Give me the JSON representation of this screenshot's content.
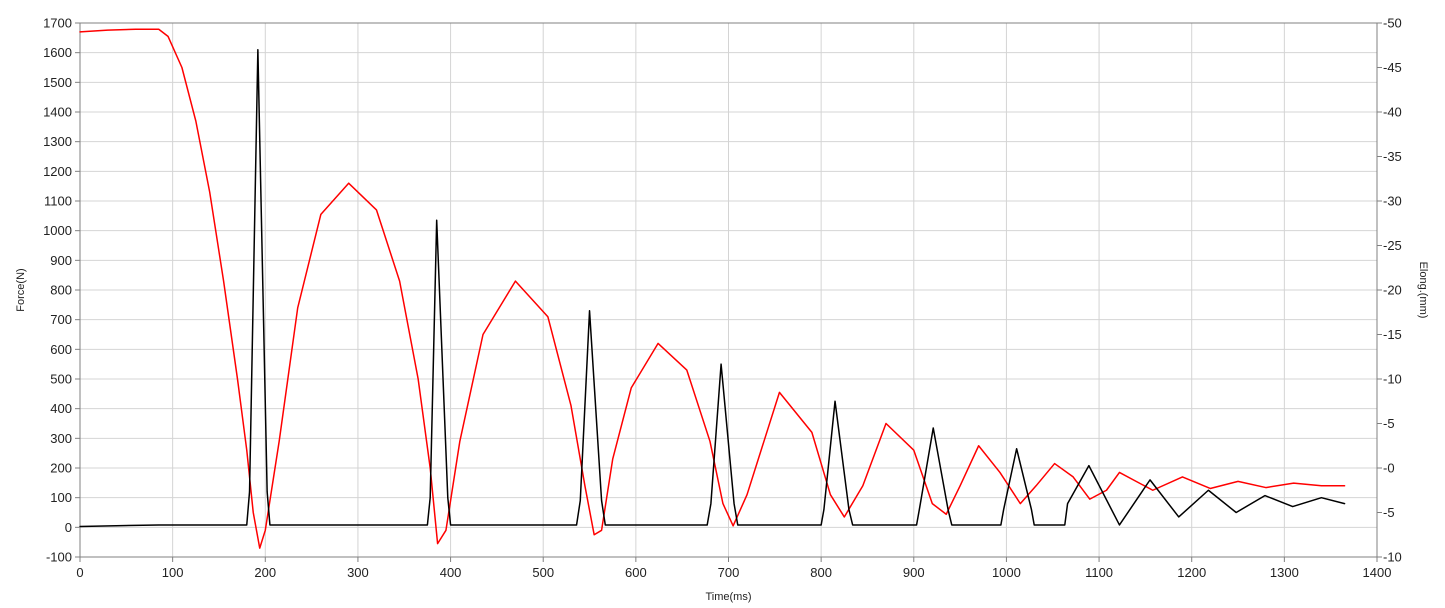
{
  "chart_data": {
    "type": "line",
    "xlabel": "Time(ms)",
    "ylabel": "Force(N)",
    "y2label": "Elong.(mm)",
    "xlim": [
      0,
      1400
    ],
    "ylim": [
      -100,
      1700
    ],
    "y2lim": [
      -10,
      50
    ],
    "x_ticks": [
      0,
      100,
      200,
      300,
      400,
      500,
      600,
      700,
      800,
      900,
      1000,
      1100,
      1200,
      1300,
      1400
    ],
    "y_ticks": [
      -100,
      0,
      100,
      200,
      300,
      400,
      500,
      600,
      700,
      800,
      900,
      1000,
      1100,
      1200,
      1300,
      1400,
      1500,
      1600,
      1700
    ],
    "y2_ticks": [
      -10,
      -5,
      0,
      5,
      10,
      15,
      20,
      25,
      30,
      35,
      40,
      45,
      50
    ],
    "grid": true,
    "colors": {
      "force": "#000000",
      "elong": "#ff0000",
      "grid": "#d4d4d4",
      "axis": "#808080"
    },
    "series": [
      {
        "axis": "left",
        "color": "#000000",
        "x": [
          0,
          85,
          180,
          183,
          192,
          202,
          205,
          375,
          378,
          385,
          397,
          400,
          536,
          540,
          550,
          563,
          567,
          677,
          681,
          692,
          706,
          710,
          800,
          803,
          815,
          830,
          834,
          903,
          906,
          921,
          937,
          941,
          994,
          997,
          1011,
          1027,
          1030,
          1063,
          1066,
          1089,
          1122,
          1155,
          1186,
          1218,
          1248,
          1279,
          1309,
          1340,
          1365
        ],
        "y": [
          3,
          8,
          8,
          120,
          1610,
          120,
          8,
          8,
          100,
          1035,
          100,
          8,
          8,
          90,
          730,
          90,
          8,
          8,
          80,
          550,
          80,
          8,
          8,
          60,
          425,
          60,
          8,
          8,
          60,
          335,
          60,
          8,
          8,
          60,
          265,
          60,
          8,
          8,
          80,
          208,
          8,
          160,
          35,
          125,
          50,
          107,
          70,
          100,
          80
        ]
      },
      {
        "axis": "right",
        "color": "#ff0000",
        "x": [
          0,
          30,
          60,
          85,
          95,
          110,
          125,
          140,
          155,
          170,
          180,
          187,
          194,
          200,
          215,
          235,
          260,
          290,
          320,
          345,
          365,
          378,
          386,
          395,
          410,
          435,
          470,
          505,
          530,
          545,
          555,
          563,
          575,
          595,
          624,
          655,
          680,
          694,
          705,
          720,
          755,
          790,
          810,
          825,
          845,
          870,
          900,
          920,
          935,
          950,
          970,
          993,
          1015,
          1032,
          1052,
          1072,
          1090,
          1108,
          1122,
          1140,
          1158,
          1190,
          1220,
          1250,
          1280,
          1310,
          1340,
          1365
        ],
        "y": [
          49,
          49.2,
          49.3,
          49.3,
          48.5,
          45,
          39,
          31,
          21,
          10,
          2,
          -5,
          -9,
          -7,
          3,
          18,
          28.5,
          32,
          29,
          21,
          10,
          0,
          -8.5,
          -7,
          3,
          15,
          21,
          17,
          7,
          -2,
          -7.5,
          -7,
          1,
          9,
          14,
          11,
          3,
          -4,
          -6.5,
          -3,
          8.5,
          4,
          -3,
          -5.5,
          -2,
          5,
          2,
          -4,
          -5.2,
          -2,
          2.5,
          -0.5,
          -4,
          -2,
          0.5,
          -1,
          -3.5,
          -2.5,
          -0.5,
          -1.5,
          -2.5,
          -1,
          -2.3,
          -1.5,
          -2.2,
          -1.7,
          -2,
          -2
        ]
      }
    ]
  }
}
